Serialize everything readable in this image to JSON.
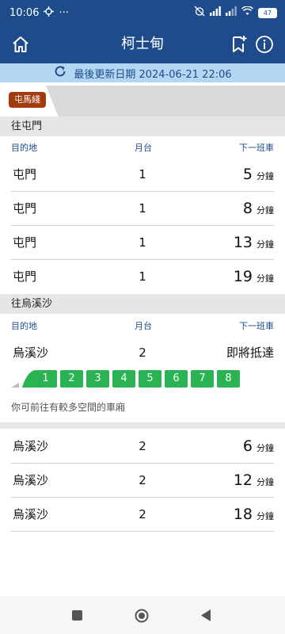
{
  "status": {
    "time": "10:06",
    "more": "···",
    "battery": "47"
  },
  "header": {
    "title": "柯士甸"
  },
  "update": {
    "label": "最後更新日期 2024-06-21 22:06"
  },
  "line_tab": {
    "label": "屯馬綫",
    "color": "#a23c0f"
  },
  "columns": {
    "destination": "目的地",
    "platform": "月台",
    "next_train": "下一班車"
  },
  "sections": [
    {
      "title": "往屯門",
      "rows": [
        {
          "destination": "屯門",
          "platform": "1",
          "eta": "5",
          "unit": "分鐘"
        },
        {
          "destination": "屯門",
          "platform": "1",
          "eta": "8",
          "unit": "分鐘"
        },
        {
          "destination": "屯門",
          "platform": "1",
          "eta": "13",
          "unit": "分鐘"
        },
        {
          "destination": "屯門",
          "platform": "1",
          "eta": "19",
          "unit": "分鐘"
        }
      ]
    },
    {
      "title": "往烏溪沙",
      "first": {
        "destination": "烏溪沙",
        "platform": "2",
        "eta_text": "即將抵達"
      },
      "cars": [
        "1",
        "2",
        "3",
        "4",
        "5",
        "6",
        "7",
        "8"
      ],
      "hint": "你可前往有較多空間的車廂",
      "rows": [
        {
          "destination": "烏溪沙",
          "platform": "2",
          "eta": "6",
          "unit": "分鐘"
        },
        {
          "destination": "烏溪沙",
          "platform": "2",
          "eta": "12",
          "unit": "分鐘"
        },
        {
          "destination": "烏溪沙",
          "platform": "2",
          "eta": "18",
          "unit": "分鐘"
        }
      ]
    }
  ],
  "colors": {
    "primary": "#1e4b8b",
    "update_bg": "#b3d7f2",
    "car_green": "#2ab352"
  }
}
